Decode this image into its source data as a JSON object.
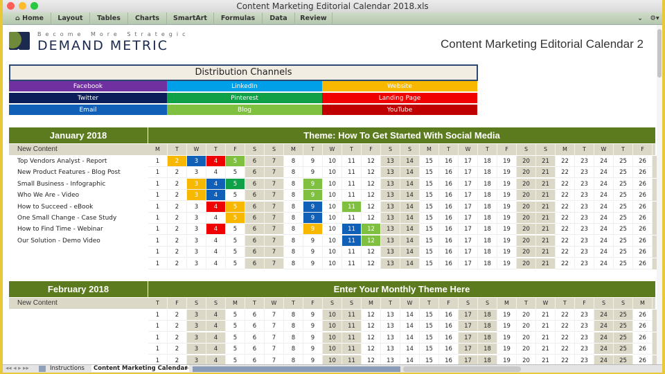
{
  "window": {
    "title": "Content Marketing Editorial Calendar 2018.xls"
  },
  "toolbar": {
    "tabs": [
      "Home",
      "Layout",
      "Tables",
      "Charts",
      "SmartArt",
      "Formulas",
      "Data",
      "Review"
    ]
  },
  "logo": {
    "tagline": "Become More Strategic",
    "brand": "DEMAND METRIC"
  },
  "doc_title": "Content Marketing Editorial Calendar 2",
  "distribution": {
    "title": "Distribution Channels",
    "channels": [
      {
        "name": "Facebook",
        "color": "#7030a0"
      },
      {
        "name": "LinkedIn",
        "color": "#00a0e8"
      },
      {
        "name": "Website",
        "color": "#f8b800"
      },
      {
        "name": "Twitter",
        "color": "#0c1e5a"
      },
      {
        "name": "Pinterest",
        "color": "#10a048"
      },
      {
        "name": "Landing Page",
        "color": "#f00000"
      },
      {
        "name": "Email",
        "color": "#1060b8"
      },
      {
        "name": "Blog",
        "color": "#80c040"
      },
      {
        "name": "YouTube",
        "color": "#c00000"
      }
    ]
  },
  "months": [
    {
      "title": "January 2018",
      "theme": "Theme: How To Get Started With Social Media",
      "content_header": "New Content",
      "day_letters": [
        "M",
        "T",
        "W",
        "T",
        "F",
        "S",
        "S",
        "M",
        "T",
        "W",
        "T",
        "F",
        "S",
        "S",
        "M",
        "T",
        "W",
        "T",
        "F",
        "S",
        "S",
        "M",
        "T",
        "W",
        "T",
        "F"
      ],
      "weekend_days": [
        6,
        7,
        13,
        14,
        20,
        21
      ],
      "rows": [
        "Top Vendors Analyst - Report",
        "New Product Features - Blog Post",
        "Small Business - Infographic",
        "Who We Are - Video",
        "How to Succeed - eBook",
        "One Small Change - Case Study",
        "How to Find Time - Webinar",
        "Our Solution - Demo Video",
        "",
        ""
      ],
      "highlights": [
        {
          "row": 0,
          "day": 2,
          "channel": "Website"
        },
        {
          "row": 0,
          "day": 3,
          "channel": "Email"
        },
        {
          "row": 0,
          "day": 4,
          "channel": "Landing Page"
        },
        {
          "row": 0,
          "day": 5,
          "channel": "Blog"
        },
        {
          "row": 2,
          "day": 3,
          "channel": "Website"
        },
        {
          "row": 2,
          "day": 4,
          "channel": "Email"
        },
        {
          "row": 2,
          "day": 5,
          "channel": "Pinterest"
        },
        {
          "row": 2,
          "day": 9,
          "channel": "Blog"
        },
        {
          "row": 3,
          "day": 3,
          "channel": "Website"
        },
        {
          "row": 3,
          "day": 4,
          "channel": "Email"
        },
        {
          "row": 3,
          "day": 9,
          "channel": "Blog"
        },
        {
          "row": 4,
          "day": 4,
          "channel": "Landing Page"
        },
        {
          "row": 4,
          "day": 5,
          "channel": "Website"
        },
        {
          "row": 4,
          "day": 9,
          "channel": "Email"
        },
        {
          "row": 4,
          "day": 11,
          "channel": "Blog"
        },
        {
          "row": 5,
          "day": 5,
          "channel": "Website"
        },
        {
          "row": 5,
          "day": 9,
          "channel": "Email"
        },
        {
          "row": 6,
          "day": 4,
          "channel": "Landing Page"
        },
        {
          "row": 6,
          "day": 9,
          "channel": "Website"
        },
        {
          "row": 6,
          "day": 11,
          "channel": "Email"
        },
        {
          "row": 6,
          "day": 12,
          "channel": "Blog"
        },
        {
          "row": 7,
          "day": 11,
          "channel": "Email"
        },
        {
          "row": 7,
          "day": 12,
          "channel": "Blog"
        }
      ]
    },
    {
      "title": "February 2018",
      "theme": "Enter Your Monthly Theme Here",
      "content_header": "New Content",
      "day_letters": [
        "T",
        "F",
        "S",
        "S",
        "M",
        "T",
        "W",
        "T",
        "F",
        "S",
        "S",
        "M",
        "T",
        "W",
        "T",
        "F",
        "S",
        "S",
        "M",
        "T",
        "W",
        "T",
        "F",
        "S",
        "S",
        "M"
      ],
      "weekend_days": [
        3,
        4,
        10,
        11,
        17,
        18,
        24,
        25
      ],
      "rows": [
        "",
        "",
        "",
        "",
        ""
      ],
      "highlights": []
    }
  ],
  "sheet_tabs": [
    "Instructions",
    "Content Marketing Calendar",
    "+"
  ]
}
